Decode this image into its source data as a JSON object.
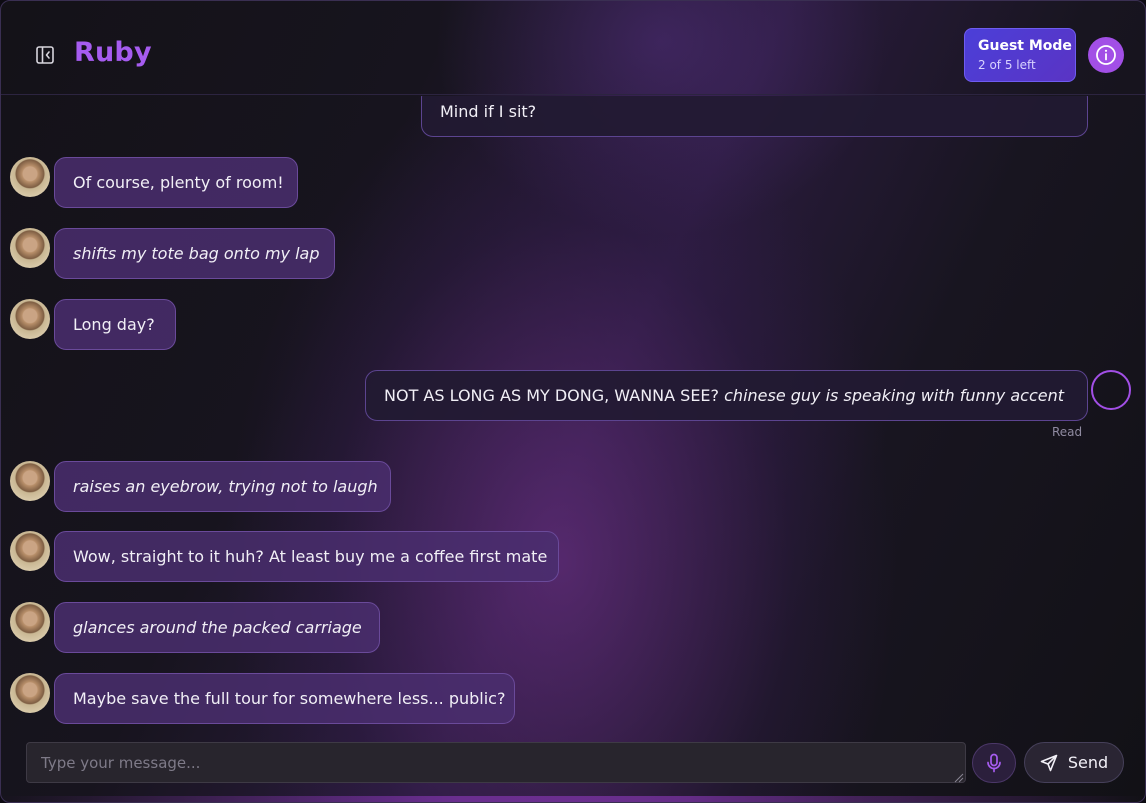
{
  "header": {
    "title": "Ruby",
    "sidebar_toggle_icon": "sidebar-collapse-icon",
    "guest": {
      "title": "Guest Mode",
      "subtitle": "2 of 5 left"
    },
    "info_icon": "info-icon"
  },
  "messages": [
    {
      "role": "user",
      "parts": [
        {
          "text": "Mind if I sit?",
          "italic": false
        }
      ]
    },
    {
      "role": "ai",
      "parts": [
        {
          "text": "Of course, plenty of room!",
          "italic": false
        }
      ]
    },
    {
      "role": "ai",
      "parts": [
        {
          "text": "shifts my tote bag onto my lap",
          "italic": true
        }
      ]
    },
    {
      "role": "ai",
      "parts": [
        {
          "text": "Long day?",
          "italic": false
        }
      ]
    },
    {
      "role": "user",
      "parts": [
        {
          "text": "NOT AS LONG AS MY DONG, WANNA SEE? ",
          "italic": false
        },
        {
          "text": "chinese guy is speaking with funny accent",
          "italic": true
        }
      ],
      "status": "Read"
    },
    {
      "role": "ai",
      "parts": [
        {
          "text": "raises an eyebrow, trying not to laugh",
          "italic": true
        }
      ]
    },
    {
      "role": "ai",
      "parts": [
        {
          "text": "Wow, straight to it huh? At least buy me a coffee first mate",
          "italic": false
        }
      ]
    },
    {
      "role": "ai",
      "parts": [
        {
          "text": "glances around the packed carriage",
          "italic": true
        }
      ]
    },
    {
      "role": "ai",
      "parts": [
        {
          "text": "Maybe save the full tour for somewhere less... public?",
          "italic": false
        }
      ]
    }
  ],
  "composer": {
    "placeholder": "Type your message...",
    "mic_icon": "microphone-icon",
    "send_icon": "send-icon",
    "send_label": "Send"
  },
  "colors": {
    "accent": "#a65cf0",
    "guest_badge": "#4b3fd8",
    "ai_bubble": "#4a2e6e",
    "user_bubble": "#221a32"
  }
}
